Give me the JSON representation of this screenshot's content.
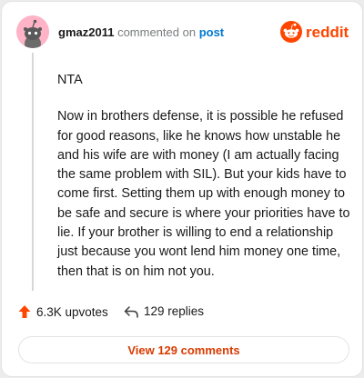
{
  "header": {
    "username": "gmaz2011",
    "action_text": "commented on",
    "post_link": "post",
    "brand_name": "reddit"
  },
  "comment": {
    "paragraphs": [
      "NTA",
      "Now in brothers defense, it is possible he refused for good reasons, like he knows how unstable he and his wife are with money (I am actually facing the same problem with SIL). But your kids have to come first. Setting them up with enough money to be safe and secure is where your priorities have to lie. If your brother is willing to end a relationship just because you wont lend him money one time, then that is on him not you."
    ]
  },
  "footer": {
    "upvotes": "6.3K upvotes",
    "replies": "129 replies",
    "view_button": "View 129 comments"
  },
  "colors": {
    "brand_orange": "#ff4500",
    "upvote_orange": "#ff4500",
    "link_blue": "#0079d3",
    "view_button_text": "#d93a00",
    "avatar_bg": "#ffb3c7"
  },
  "icons": {
    "avatar": "snoo-avatar-icon",
    "brand": "reddit-logo-icon",
    "upvote": "upvote-arrow-icon",
    "reply": "reply-arrow-icon"
  }
}
